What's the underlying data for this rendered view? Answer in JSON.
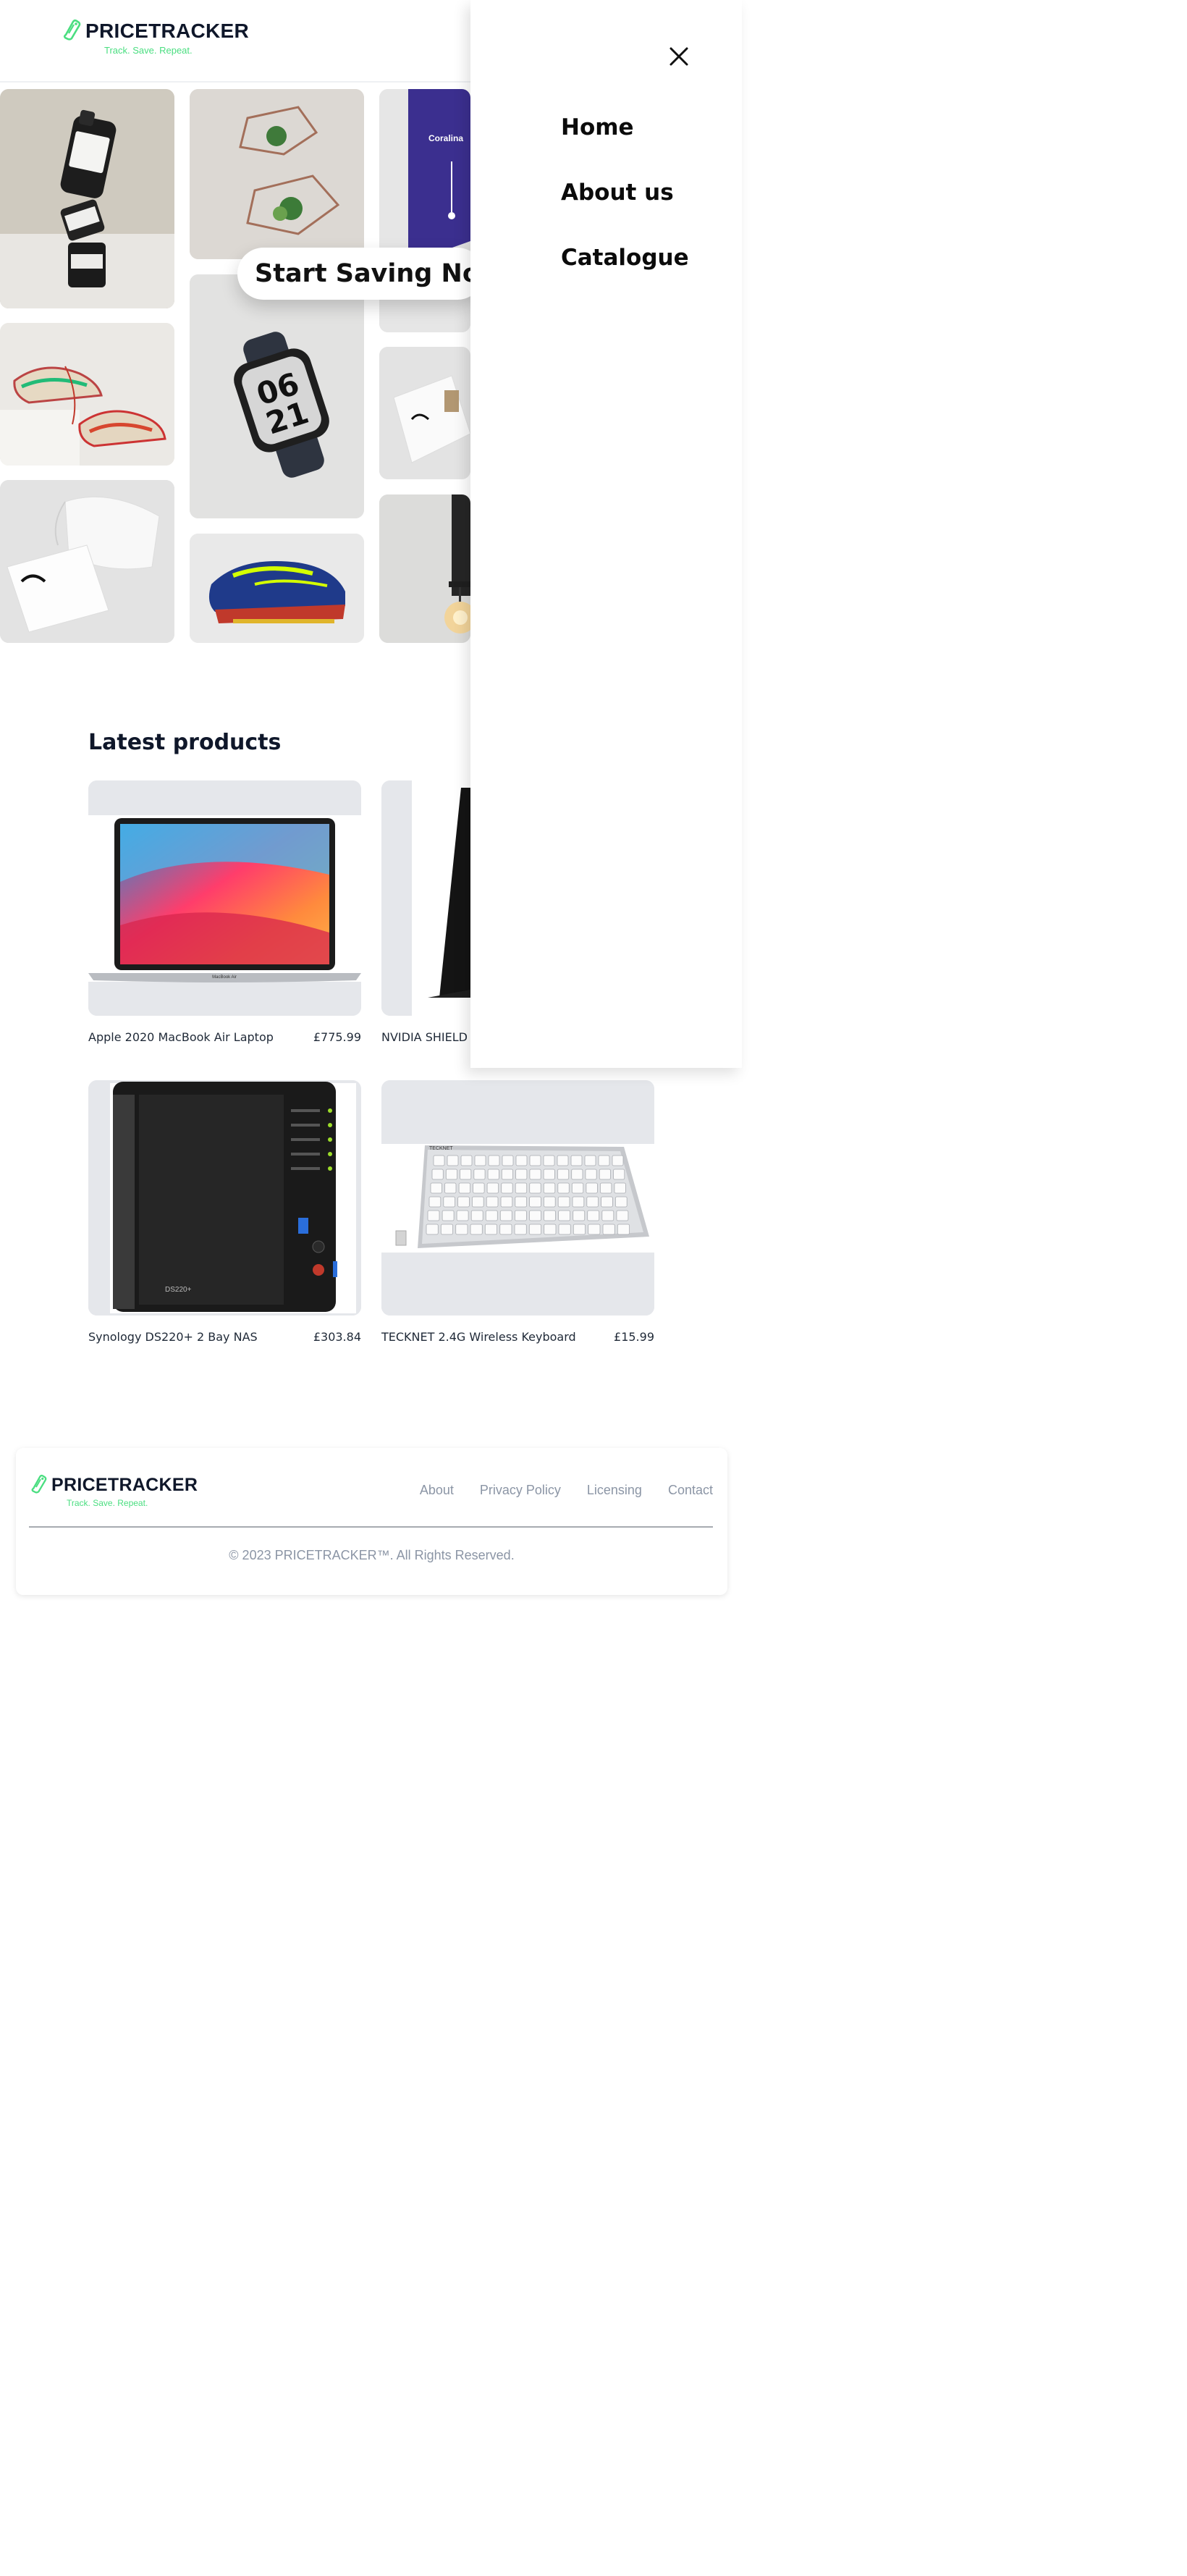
{
  "brand": {
    "name": "PRICETRACKER",
    "tagline": "Track. Save. Repeat.",
    "accent_color": "#4ade80",
    "logo_icon": "price-tag-icon"
  },
  "hero": {
    "cta": "Start Saving Now",
    "watch_face": {
      "line1": "06",
      "line2": "21"
    },
    "tube_label": "Coralina"
  },
  "drawer": {
    "close_icon": "close-icon",
    "menu_items": [
      {
        "label": "Home"
      },
      {
        "label": "About us"
      },
      {
        "label": "Catalogue"
      }
    ]
  },
  "latest": {
    "title": "Latest products",
    "products": [
      {
        "name": "Apple 2020 MacBook Air Laptop",
        "price": "£775.99",
        "image_icon": "laptop-image"
      },
      {
        "name": "NVIDIA SHIELD",
        "price": "",
        "image_icon": "streaming-device-image"
      },
      {
        "name": "Synology DS220+ 2 Bay NAS",
        "price": "£303.84",
        "image_icon": "nas-image"
      },
      {
        "name": "TECKNET 2.4G Wireless Keyboard",
        "price": "£15.99",
        "image_icon": "keyboard-image"
      }
    ],
    "laptop_brand": "MacBook Air",
    "nas_model": "DS220+",
    "keyboard_brand": "TECKNET"
  },
  "footer": {
    "links": [
      "About",
      "Privacy Policy",
      "Licensing",
      "Contact"
    ],
    "copyright": "© 2023 PRICETRACKER™. All Rights Reserved."
  }
}
